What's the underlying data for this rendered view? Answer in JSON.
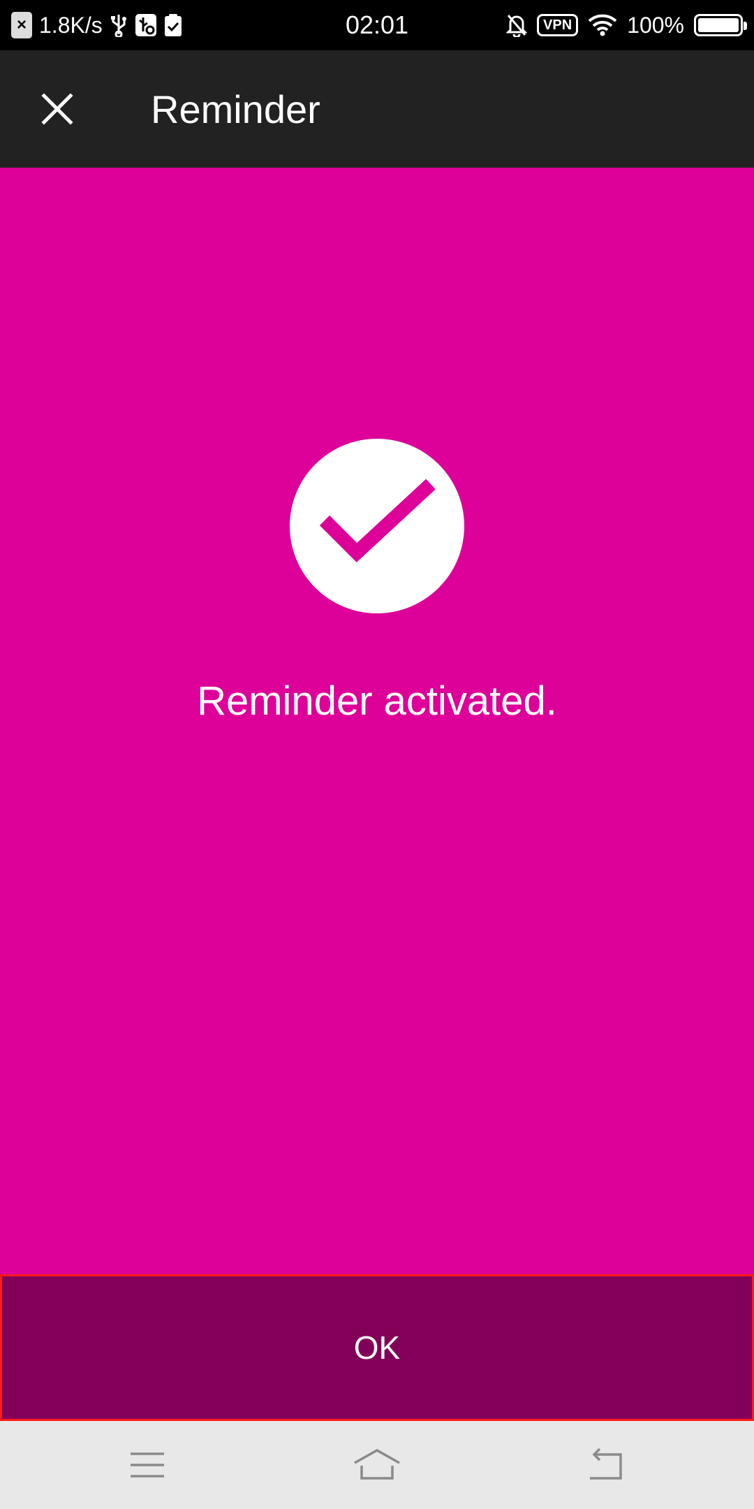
{
  "status_bar": {
    "notification_badge": "×",
    "net_speed": "1.8K/s",
    "time": "02:01",
    "vpn_label": "VPN",
    "battery_percent": "100%",
    "battery_level": 1.0
  },
  "app_bar": {
    "title": "Reminder",
    "close_icon": "close-icon"
  },
  "main": {
    "check_icon": "checkmark-icon",
    "message": "Reminder activated."
  },
  "actions": {
    "ok_label": "OK"
  },
  "nav_bar": {
    "icons": [
      "menu-icon",
      "home-icon",
      "back-icon"
    ]
  },
  "colors": {
    "background": "#dd0099",
    "app_bar": "#222222",
    "ok_button": "#830059",
    "nav_bar": "#e8e8e8"
  }
}
